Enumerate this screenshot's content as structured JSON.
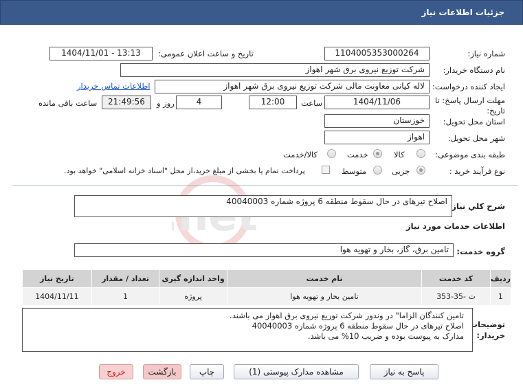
{
  "window_title": "جزئیات اطلاعات نیاز",
  "labels": {
    "need_number": "شماره نیاز:",
    "announce_datetime": "تاریخ و ساعت اعلان عمومی:",
    "buyer_org": "نام دستگاه خریدار:",
    "requester": "ایجاد کننده درخواست:",
    "buyer_contact": "اطلاعات تماس خریدار",
    "deadline": "مهلت ارسال پاسخ: تا تاریخ:",
    "time_word": "ساعت",
    "day_and": "روز و",
    "remaining": "ساعت باقی مانده",
    "province": "استان محل تحویل:",
    "city": "شهر محل تحویل:",
    "category": "طبقه بندی موضوعی:",
    "purchase_type": "نوع فرآیند خرید :",
    "general_desc": "شرح کلي نیاز:",
    "services_info": "اطلاعات خدمات مورد نیاز",
    "service_group": "گروه خدمت:",
    "buyer_notes": "توضیحات خریدار:"
  },
  "values": {
    "need_number": "1104005353000264",
    "announce_datetime": "1404/11/01 - 13:13",
    "buyer_org": "شرکت توزیع نیروی برق شهر اهواز",
    "requester": "لاله کیانی معاونت مالی  شرکت توزیع نیروی برق شهر اهواز",
    "deadline_date": "1404/11/06",
    "deadline_time": "12:00",
    "days_left": "4",
    "time_left": "21:49:56",
    "province": "خوزستان",
    "city": "اهواز",
    "general_desc": "اصلاح تیرهای در حال سقوط منطقه 6 پروژه شماره 40040003",
    "service_group": "تامین برق، گاز، بخار و تهویه هوا",
    "buyer_notes_lines": [
      "تامین کنندگان الزاما\" در وندور شرکت توزیع نیروی برق اهواز می باشند.",
      "اصلاح تیرهای در حال سقوط منطقه 6 پروژه شماره 40040003",
      "مدارک به پیوست بوده و ضریب 10% می باشد."
    ]
  },
  "category_options": [
    "کالا",
    "خدمت",
    "کالا/خدمت"
  ],
  "category_selected": "خدمت",
  "purchase_options": [
    "جزیی",
    "متوسط"
  ],
  "purchase_selected": "جزیی",
  "payment_note": "پرداخت تمام یا بخشی از مبلغ خرید،از محل \"اسناد خزانه اسلامی\" خواهد بود.",
  "table": {
    "headers": [
      "ردیف",
      "کد خدمت",
      "نام خدمت",
      "واحد اندازه گیری",
      "تعداد / مقدار",
      "تاریخ نیاز"
    ],
    "rows": [
      [
        "1",
        "ت -35-353",
        "تامین بخار و تهویه هوا",
        "پروژه",
        "1",
        "1404/11/11"
      ]
    ]
  },
  "buttons": {
    "reply": "پاسخ به نیاز",
    "attachments": "مشاهده مدارک پیوستی (1)",
    "print": "چاپ",
    "back": "بازگشت",
    "exit": "خروج"
  },
  "watermark_text": "AriaTender.net",
  "colors": {
    "title_bar": "#3a5a8c",
    "link": "#1a53b8",
    "exit_button": "#f7d0d0"
  }
}
